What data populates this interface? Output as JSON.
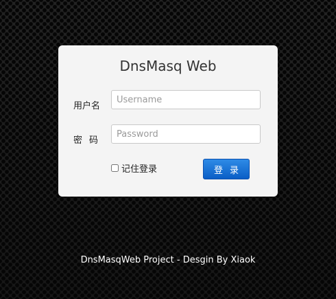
{
  "login": {
    "title": "DnsMasq Web",
    "username_label": "用户名",
    "username_placeholder": "Username",
    "username_value": "",
    "password_label": "密码",
    "password_placeholder": "Password",
    "password_value": "",
    "remember_label": "记住登录",
    "remember_checked": false,
    "submit_label": "登录"
  },
  "footer": {
    "text": "DnsMasqWeb Project - Desgin By Xiaok"
  },
  "colors": {
    "background": "#1b1b1b",
    "panel": "#f4f4f4",
    "button": "#0a5ec6",
    "footer_text": "#ffffff"
  }
}
